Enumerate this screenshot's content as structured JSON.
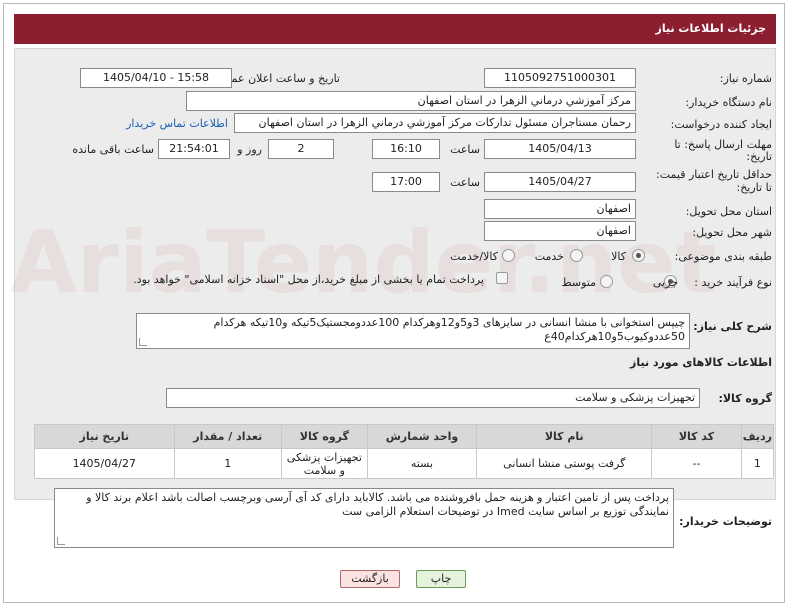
{
  "header": {
    "title": "جزئیات اطلاعات نیاز"
  },
  "fields": {
    "need_number": {
      "label": "شماره نیاز:",
      "value": "1105092751000301"
    },
    "public_announce": {
      "label": "تاریخ و ساعت اعلان عمومی:",
      "value": "1405/04/10 - 15:58"
    },
    "buyer_org": {
      "label": "نام دستگاه خریدار:",
      "value": "مرکز آموزشي درماني الزهرا در استان اصفهان"
    },
    "requester": {
      "label": "ایجاد کننده درخواست:",
      "value": "رحمان مستاجران مسئول تدارکات مرکز آموزشي درماني الزهرا در استان اصفهان",
      "contact_link": "اطلاعات تماس خریدار"
    },
    "reply_deadline": {
      "label_line1": "مهلت ارسال پاسخ: تا",
      "label_line2": "تاریخ:",
      "date": "1405/04/13",
      "time_label": "ساعت",
      "time": "16:10",
      "days": "2",
      "days_label": "روز و",
      "remaining": "21:54:01",
      "remaining_label": "ساعت باقی مانده"
    },
    "price_validity": {
      "label_line1": "حداقل تاریخ اعتبار قیمت:",
      "label_line2": "تا تاریخ:",
      "date": "1405/04/27",
      "time_label": "ساعت",
      "time": "17:00"
    },
    "delivery_province": {
      "label": "استان محل تحویل:",
      "value": "اصفهان"
    },
    "delivery_city": {
      "label": "شهر محل تحویل:",
      "value": "اصفهان"
    },
    "category": {
      "label": "طبقه بندی موضوعی:",
      "options": [
        "کالا",
        "خدمت",
        "کالا/خدمت"
      ],
      "selected": "کالا"
    },
    "purchase_type": {
      "label": "نوع فرآیند خرید :",
      "options": [
        "جزیی",
        "متوسط"
      ],
      "selected": "جزیی",
      "note": "پرداخت تمام یا بخشی از مبلغ خرید،از محل \"اسناد خزانه اسلامی\" خواهد بود."
    },
    "description": {
      "label": "شرح کلی نیاز:",
      "value": "چیپس استخوانی با منشا انسانی در سایزهای 3و5و12وهرکدام 100عددومجستیک5تیکه و10تیکه هرکدام 50عددوکیوب5و10هرکدام40ع"
    }
  },
  "items_section": {
    "title": "اطلاعات کالاهای مورد نیاز",
    "group_label": "گروه کالا:",
    "group_value": "تجهیزات پزشکی و سلامت"
  },
  "table": {
    "headers": [
      "ردیف",
      "کد کالا",
      "نام کالا",
      "واحد شمارش",
      "گروه کالا",
      "تعداد / مقدار",
      "تاریخ نیاز"
    ],
    "rows": [
      [
        "1",
        "--",
        "گرفت پوستی منشا انسانی",
        "بسته",
        "تجهیزات پزشکی و سلامت",
        "1",
        "1405/04/27"
      ]
    ]
  },
  "buyer_notes": {
    "label": "توضیحات خریدار:",
    "value": "پرداخت  پس از تامین اعتبار و هزینه حمل بافروشنده می باشد. کالاباید دارای کد آی آرسی وبرچسب اصالت باشد اعلام برند کالا و نمایندگی توزیع بر اساس سایت Imed در توضیحات استعلام الزامی ست"
  },
  "buttons": {
    "print": "چاپ",
    "back": "بازگشت"
  },
  "watermark": "AriaTender.net"
}
